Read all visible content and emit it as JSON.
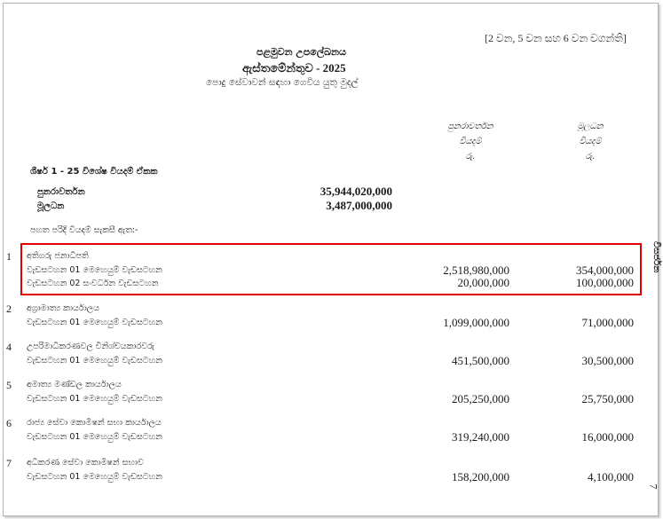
{
  "header": {
    "ref": "[2 වන, 5 වන සහ 6 වන වගන්ති]",
    "line1": "පළමුවන උපලේඛනය",
    "line2": "ඇස්තමේන්තුව - 2025",
    "line3": "පොදු සේවාවන් සඳහා ගෙවිය යුතු මුදල්"
  },
  "columns": {
    "recurrent": [
      "පුනරාවර්තන",
      "වියදම්",
      "රු."
    ],
    "capital": [
      "මූලධන",
      "වියදම්",
      "රු."
    ]
  },
  "summary": {
    "heading": "ශීර්ෂ 1 - 25 විශේෂ වියදම් ඒකක",
    "rows": [
      {
        "label": "පුනරාවර්තන",
        "value": "35,944,020,000"
      },
      {
        "label": "මූලධන",
        "value": "3,487,000,000"
      }
    ],
    "note": "පහත පරිදි වියදම් සැකසී ඇත:-"
  },
  "entries": [
    {
      "num": "1",
      "title": "අතිගරු ජනාධිපති",
      "programs": [
        {
          "label": "වැඩසටහන 01    මෙහෙයුම් වැඩසටහන",
          "recurrent": "2,518,980,000",
          "capital": "354,000,000"
        },
        {
          "label": "වැඩසටහන 02    සංවර්ධන වැඩසටහන",
          "recurrent": "20,000,000",
          "capital": "100,000,000"
        }
      ]
    },
    {
      "num": "2",
      "title": "අග්‍රාමාත්‍ය කාර්යාලය",
      "programs": [
        {
          "label": "වැඩසටහන 01    මෙහෙයුම් වැඩසටහන",
          "recurrent": "1,099,000,000",
          "capital": "71,000,000"
        }
      ]
    },
    {
      "num": "4",
      "title": "උපරිමාධිකරණවල විනිශ්චයකාරවරු",
      "programs": [
        {
          "label": "වැඩසටහන 01    මෙහෙයුම් වැඩසටහන",
          "recurrent": "451,500,000",
          "capital": "30,500,000"
        }
      ]
    },
    {
      "num": "5",
      "title": "අමාත්‍ය මණ්ඩල කාර්යාලය",
      "programs": [
        {
          "label": "වැඩසටහන 01    මෙහෙයුම් වැඩසටහන",
          "recurrent": "205,250,000",
          "capital": "25,750,000"
        }
      ]
    },
    {
      "num": "6",
      "title": "රාජ්‍ය සේවා කොමිෂන් සභා කාර්යාලය",
      "programs": [
        {
          "label": "වැඩසටහන 01    මෙහෙයුම් වැඩසටහන",
          "recurrent": "319,240,000",
          "capital": "16,000,000"
        }
      ]
    },
    {
      "num": "7",
      "title": "අධිකරණ සේවා කොමිෂන් සභාව",
      "programs": [
        {
          "label": "වැඩසටහන 01    මෙහෙයුම් වැඩසටහන",
          "recurrent": "158,200,000",
          "capital": "4,100,000"
        }
      ]
    }
  ],
  "side_label": "විසර්ජන",
  "page_number": "7",
  "colors": {
    "highlight": "#e00000"
  }
}
